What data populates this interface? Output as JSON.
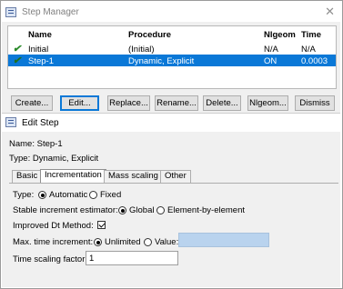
{
  "step_manager": {
    "title": "Step Manager",
    "close_glyph": "✕",
    "columns": [
      "Name",
      "Procedure",
      "Nlgeom",
      "Time"
    ],
    "rows": [
      {
        "check": "✔",
        "name": "Initial",
        "procedure": "(Initial)",
        "nlgeom": "N/A",
        "time": "N/A",
        "selected": false
      },
      {
        "check": "✔",
        "name": "Step-1",
        "procedure": "Dynamic, Explicit",
        "nlgeom": "ON",
        "time": "0.0003",
        "selected": true
      }
    ],
    "buttons": {
      "create": "Create...",
      "edit": "Edit...",
      "replace": "Replace...",
      "rename": "Rename...",
      "delete": "Delete...",
      "nlgeom": "Nlgeom...",
      "dismiss": "Dismiss"
    }
  },
  "edit_step": {
    "title": "Edit Step",
    "name_line": "Name:  Step-1",
    "type_line": "Type:  Dynamic, Explicit",
    "tabs": [
      "Basic",
      "Incrementation",
      "Mass scaling",
      "Other"
    ],
    "active_tab": "Incrementation",
    "type_label": "Type:",
    "type_options": [
      "Automatic",
      "Fixed"
    ],
    "stable_label": "Stable increment estimator:",
    "stable_options": [
      "Global",
      "Element-by-element"
    ],
    "improved_dt_label": "Improved Dt Method:",
    "improved_dt_checked": true,
    "max_inc_label": "Max. time increment:",
    "max_inc_options": [
      "Unlimited",
      "Value:"
    ],
    "max_inc_value": "",
    "time_scaling_label": "Time scaling factor:",
    "time_scaling_value": "1"
  },
  "colors": {
    "selection": "#0a78d7",
    "checkmark": "#2a8a2a",
    "disabled_field": "#b9d3ee"
  },
  "icons": [
    "app-icon",
    "close-icon",
    "check-icon"
  ]
}
